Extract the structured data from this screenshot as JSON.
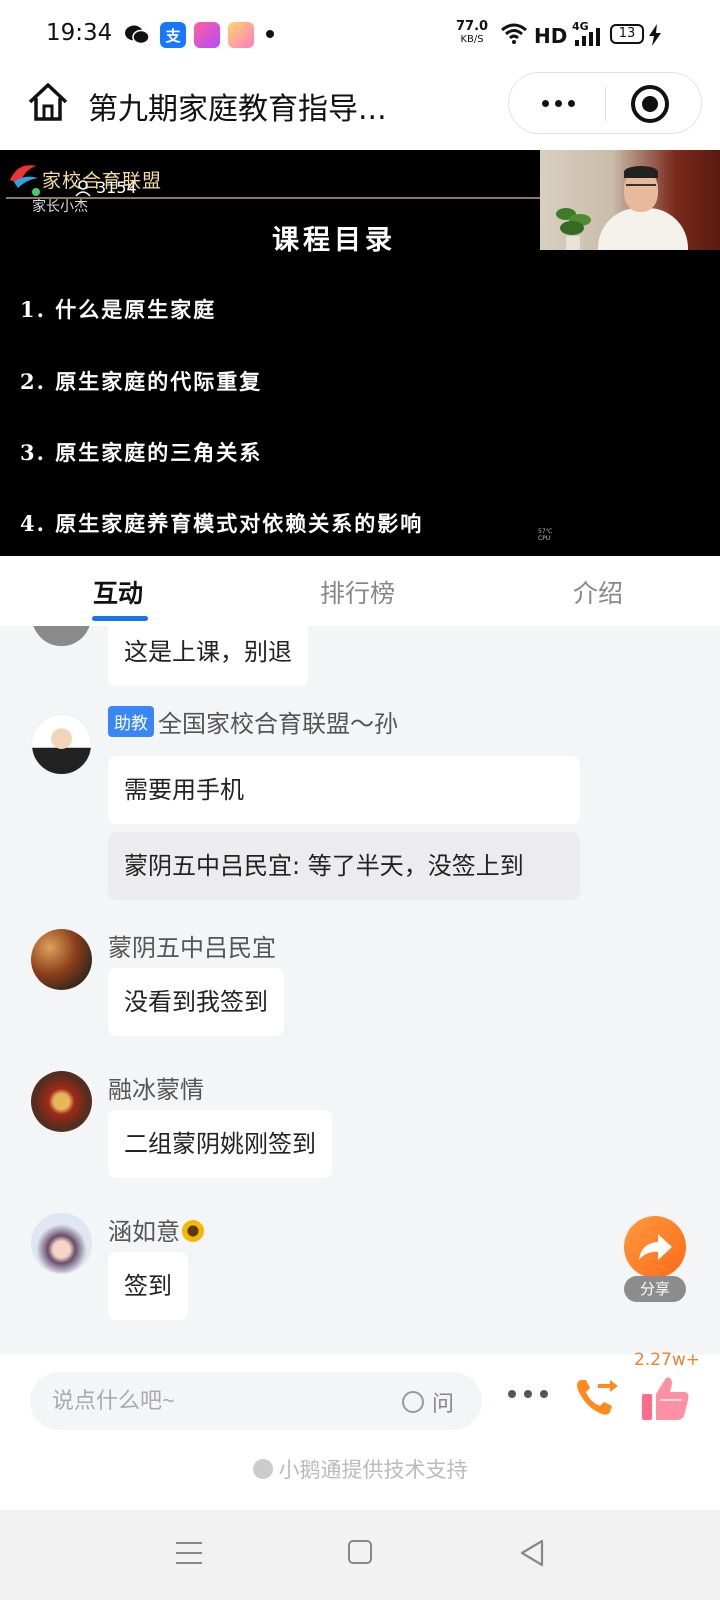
{
  "status_bar": {
    "time": "19:34",
    "net_speed": "77.0",
    "net_unit": "KB/S",
    "hd": "HD",
    "network": "4G",
    "battery": "13"
  },
  "header": {
    "title": "第九期家庭教育指导..."
  },
  "video": {
    "brand": "家校合育联盟",
    "sub_brand": "家长小杰",
    "viewer_count": "3154",
    "heading": "课程目录",
    "items": [
      "1. 什么是原生家庭",
      "2. 原生家庭的代际重复",
      "3. 原生家庭的三角关系",
      "4. 原生家庭养育模式对依赖关系的影响"
    ],
    "cpu_text_1": "57℃",
    "cpu_text_2": "CPU"
  },
  "tabs": [
    {
      "label": "互动",
      "active": true
    },
    {
      "label": "排行榜",
      "active": false
    },
    {
      "label": "介绍",
      "active": false
    }
  ],
  "chat": {
    "partial_message": "这是上课，别退",
    "messages": [
      {
        "badge": "助教",
        "name": "全国家校合育联盟～孙",
        "text": "需要用手机",
        "quote": "蒙阴五中吕民宜: 等了半天，没签上到"
      },
      {
        "name": "蒙阴五中吕民宜",
        "text": "没看到我签到"
      },
      {
        "name": "融冰蒙情",
        "text": "二组蒙阴姚刚签到"
      },
      {
        "name": "涵如意",
        "text": "签到"
      }
    ]
  },
  "share": {
    "label": "分享"
  },
  "input": {
    "placeholder": "说点什么吧~",
    "ask_label": "问",
    "like_count": "2.27w+"
  },
  "footer": {
    "powered_by": "小鹅通提供技术支持"
  },
  "colors": {
    "accent": "#1a73e8",
    "badge": "#3a86f7",
    "share": "#ff7a2a",
    "like_count": "#e9832f",
    "chat_bg": "#f4f5f7"
  },
  "icons": [
    "home-icon",
    "more-icon",
    "close-icon",
    "share-icon",
    "call-icon",
    "like-icon"
  ]
}
